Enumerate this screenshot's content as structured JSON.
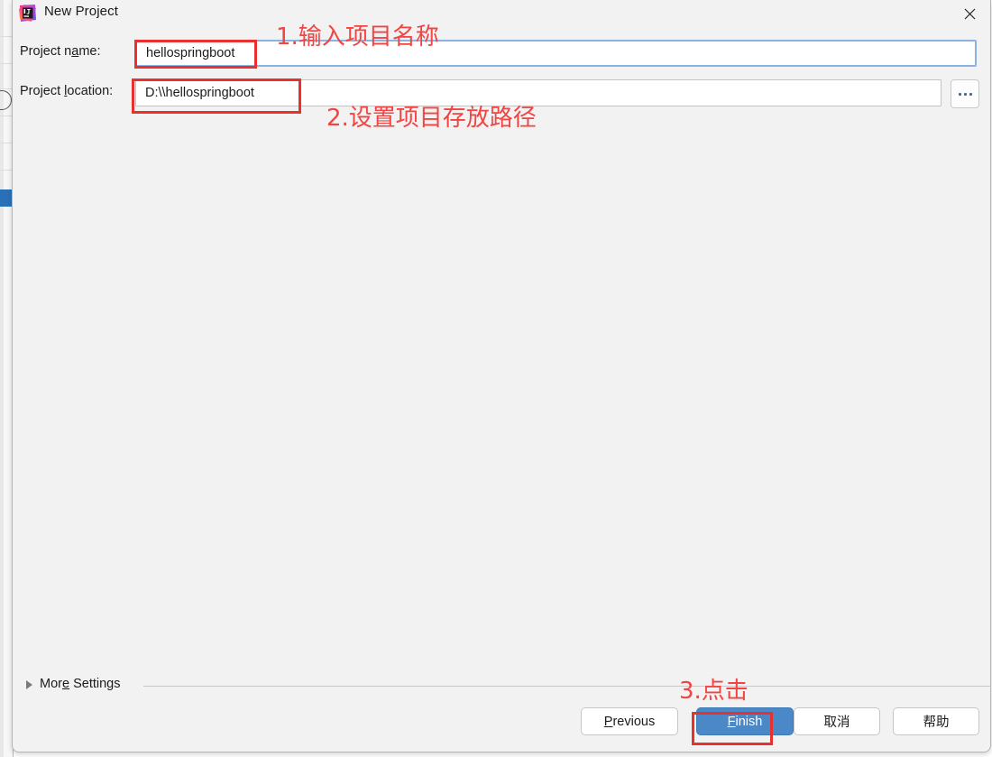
{
  "window": {
    "title": "New Project",
    "app_icon": "intellij-idea-icon",
    "close_icon": "close-icon"
  },
  "form": {
    "name_label_pre": "Project n",
    "name_label_mnemonic": "a",
    "name_label_post": "me:",
    "name_value": "hellospringboot",
    "location_label_pre": "Project ",
    "location_label_mnemonic": "l",
    "location_label_post": "ocation:",
    "location_value": "D:\\\\hellospringboot",
    "browse_button": "...",
    "browse_icon": "ellipsis-icon"
  },
  "annotations": {
    "step1": "1.输入项目名称",
    "step2": "2.设置项目存放路径",
    "step3": "3.点击",
    "highlight_color": "#e8302f",
    "text_color": "#f04543"
  },
  "more_settings": {
    "label_pre": "Mor",
    "label_mnemonic": "e",
    "label_post": " Settings",
    "expand_icon": "chevron-right-icon"
  },
  "footer": {
    "previous_pre": "",
    "previous_mnemonic": "P",
    "previous_post": "revious",
    "finish_pre": "",
    "finish_mnemonic": "F",
    "finish_post": "inish",
    "cancel": "取消",
    "help": "帮助",
    "primary_color": "#4a88c7"
  }
}
